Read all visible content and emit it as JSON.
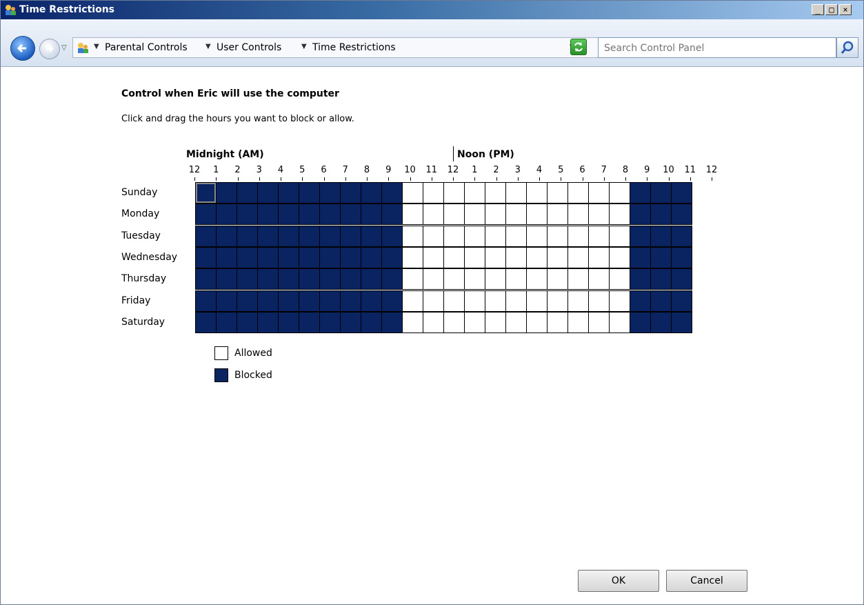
{
  "window": {
    "title": "Time Restrictions"
  },
  "caption_buttons": {
    "minimize": "_",
    "maximize": "□",
    "close": "×"
  },
  "address": {
    "breadcrumbs": [
      "Parental Controls",
      "User Controls",
      "Time Restrictions"
    ],
    "search_placeholder": "Search Control Panel"
  },
  "content": {
    "heading": "Control when Eric will use the computer",
    "instructions": "Click and drag the hours you want to block or allow.",
    "am_label": "Midnight (AM)",
    "pm_label": "Noon (PM)",
    "hour_labels": [
      "12",
      "1",
      "2",
      "3",
      "4",
      "5",
      "6",
      "7",
      "8",
      "9",
      "10",
      "11",
      "12",
      "1",
      "2",
      "3",
      "4",
      "5",
      "6",
      "7",
      "8",
      "9",
      "10",
      "11",
      "12"
    ],
    "days": [
      "Sunday",
      "Monday",
      "Tuesday",
      "Wednesday",
      "Thursday",
      "Friday",
      "Saturday"
    ],
    "schedule_pattern": "BBBBBBBBBBAAAAAAAAAAABBBB",
    "legend": {
      "allowed": "Allowed",
      "blocked": "Blocked"
    },
    "colors": {
      "blocked": "#0a2461",
      "allowed": "#ffffff"
    }
  },
  "buttons": {
    "ok": "OK",
    "cancel": "Cancel"
  }
}
